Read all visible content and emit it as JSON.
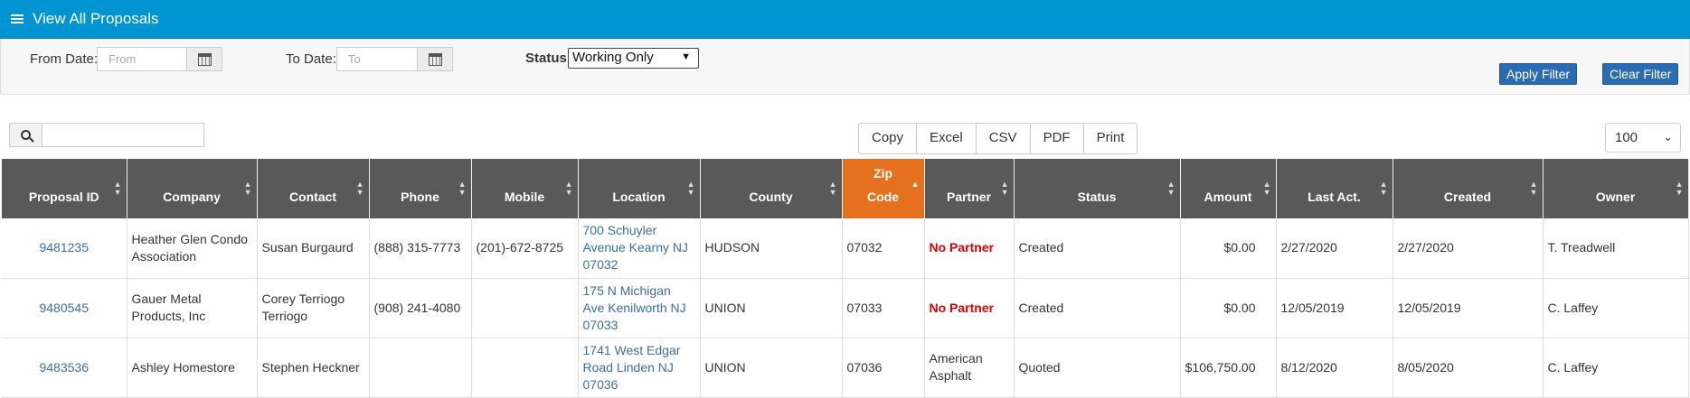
{
  "header": {
    "title": "View All Proposals",
    "icon": "list-icon",
    "color": "#0095d2"
  },
  "filters": {
    "from_label": "From Date:",
    "from_placeholder": "From",
    "to_label": "To Date:",
    "to_placeholder": "To",
    "status_label": "Status",
    "status_value": "Working Only",
    "apply_label": "Apply Filter",
    "clear_label": "Clear Filter"
  },
  "toolbar": {
    "search_value": "",
    "export_buttons": [
      "Copy",
      "Excel",
      "CSV",
      "PDF",
      "Print"
    ],
    "page_size": "100"
  },
  "table": {
    "columns": [
      "Proposal ID",
      "Company",
      "Contact",
      "Phone",
      "Mobile",
      "Location",
      "County",
      "Zip Code",
      "Partner",
      "Status",
      "Amount",
      "Last Act.",
      "Created",
      "Owner"
    ],
    "sorted_column": "Zip Code",
    "rows": [
      {
        "id": "9481235",
        "company": "Heather Glen Condo Association",
        "contact": "Susan Burgaurd",
        "phone": "(888) 315-7773",
        "mobile": "(201)-672-8725",
        "location": "700 Schuyler Avenue Kearny NJ 07032",
        "county": "HUDSON",
        "zip": "07032",
        "partner": "No Partner",
        "status": "Created",
        "amount": "$0.00",
        "last_act": "2/27/2020",
        "created": "2/27/2020",
        "owner": "T. Treadwell"
      },
      {
        "id": "9480545",
        "company": "Gauer Metal Products, Inc",
        "contact": "Corey Terriogo Terriogo",
        "phone": "(908) 241-4080",
        "mobile": "",
        "location": "175 N Michigan Ave Kenilworth NJ 07033",
        "county": "UNION",
        "zip": "07033",
        "partner": "No Partner",
        "status": "Created",
        "amount": "$0.00",
        "last_act": "12/05/2019",
        "created": "12/05/2019",
        "owner": "C. Laffey"
      },
      {
        "id": "9483536",
        "company": "Ashley Homestore",
        "contact": "Stephen Heckner",
        "phone": "",
        "mobile": "",
        "location": "1741 West Edgar Road Linden NJ 07036",
        "county": "UNION",
        "zip": "07036",
        "partner": "American Asphalt",
        "status": "Quoted",
        "amount": "$106,750.00",
        "last_act": "8/12/2020",
        "created": "8/05/2020",
        "owner": "C. Laffey"
      }
    ]
  }
}
